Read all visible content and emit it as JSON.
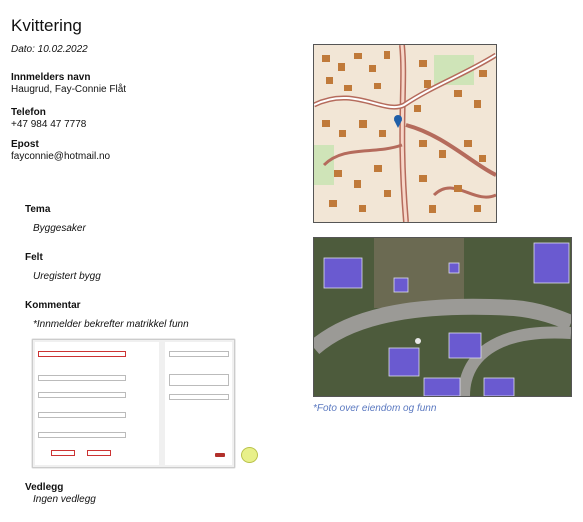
{
  "receipt": {
    "title": "Kvittering",
    "date": "Dato: 10.02.2022"
  },
  "reporter": {
    "name_label": "Innmelders navn",
    "name_value": "Haugrud, Fay-Connie Flåt",
    "phone_label": "Telefon",
    "phone_value": "+47 984 47 7778",
    "email_label": "Epost",
    "email_value": "fayconnie@hotmail.no"
  },
  "sections": {
    "tema_label": "Tema",
    "tema_value": "Byggesaker",
    "felt_label": "Felt",
    "felt_value": "Uregistert bygg",
    "kommentar_label": "Kommentar",
    "kommentar_value": "*Innmelder bekrefter matrikkel funn",
    "vedlegg_label": "Vedlegg",
    "vedlegg_value": "Ingen vedlegg"
  },
  "photo_caption": "*Foto over eiendom og funn",
  "colors": {
    "map_bg": "#f2e6d6",
    "building": "#c07a3a",
    "road": "#b56b5c",
    "caption": "#5a78c0",
    "solar": "#6a5ad0",
    "marker": "#1f5fa8"
  }
}
